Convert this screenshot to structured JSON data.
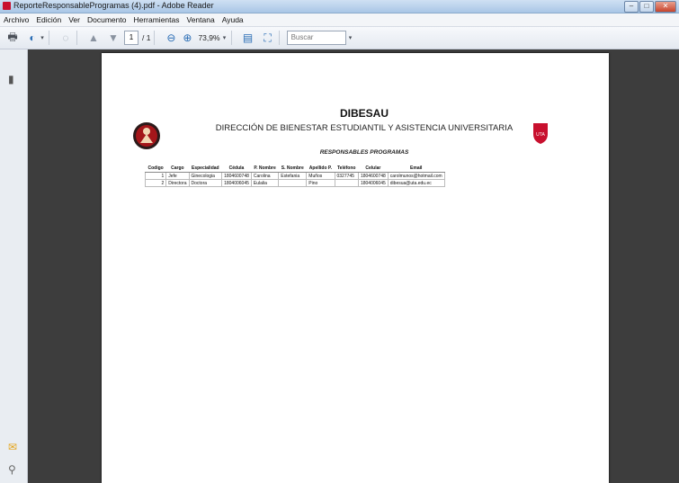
{
  "window": {
    "title": "ReporteResponsableProgramas (4).pdf - Adobe Reader"
  },
  "menu": [
    "Archivo",
    "Edición",
    "Ver",
    "Documento",
    "Herramientas",
    "Ventana",
    "Ayuda"
  ],
  "toolbar": {
    "current_page": "1",
    "page_total": "/ 1",
    "zoom": "73,9%",
    "search_placeholder": "Buscar"
  },
  "document": {
    "title": "DIBESAU",
    "subtitle": "DIRECCIÓN DE BIENESTAR ESTUDIANTIL Y ASISTENCIA UNIVERSITARIA",
    "section": "RESPONSABLES PROGRAMAS",
    "logo_right_text": "UTA",
    "table": {
      "headers": [
        "Codigo",
        "Cargo",
        "Especialidad",
        "Cédula",
        "P. Nombre",
        "S. Nombre",
        "Apellido P.",
        "Teléfono",
        "Celular",
        "Email"
      ],
      "rows": [
        [
          "1",
          "Jefe",
          "Ginecologia",
          "1804600748",
          "Carolina",
          "Estefania",
          "Muños",
          "0327745",
          "1804600748",
          "carolmunos@hotmail.com"
        ],
        [
          "2",
          "Directora",
          "Doctora",
          "1804006045",
          "Eulalia",
          "",
          "Pino",
          "",
          "1804006045",
          "dibesua@uta.edu.ec"
        ]
      ]
    }
  },
  "colors": {
    "accent": "#c8102e",
    "viewer_bg": "#3d3d3d"
  }
}
